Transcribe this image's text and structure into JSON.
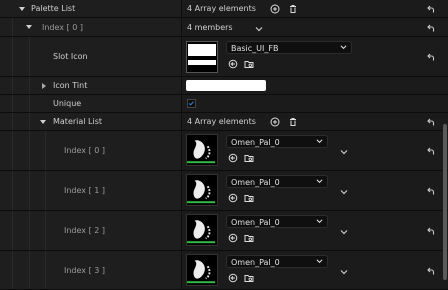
{
  "palette_list": {
    "label": "Palette List",
    "count": "4 Array elements"
  },
  "index0": {
    "label": "Index [ 0 ]",
    "members": "4 members",
    "slot_icon": {
      "label": "Slot Icon",
      "value": "Basic_UI_FB"
    },
    "icon_tint": {
      "label": "Icon Tint",
      "color": "#ffffff"
    },
    "unique": {
      "label": "Unique",
      "checked": true
    },
    "material_list": {
      "label": "Material List",
      "count": "4 Array elements",
      "items": [
        {
          "index": "Index [ 0 ]",
          "value": "Omen_Pal_0"
        },
        {
          "index": "Index [ 1 ]",
          "value": "Omen_Pal_0"
        },
        {
          "index": "Index [ 2 ]",
          "value": "Omen_Pal_0"
        },
        {
          "index": "Index [ 3 ]",
          "value": "Omen_Pal_0"
        }
      ]
    }
  },
  "colors": {
    "accent_blue": "#2f7fd6",
    "thumb_green": "#35c04a"
  },
  "icons": [
    "chevron-down-icon",
    "chevron-right-icon",
    "add-circle-icon",
    "trash-icon",
    "reset-arrow-icon",
    "use-selected-icon",
    "browse-icon",
    "checkmark-icon"
  ]
}
